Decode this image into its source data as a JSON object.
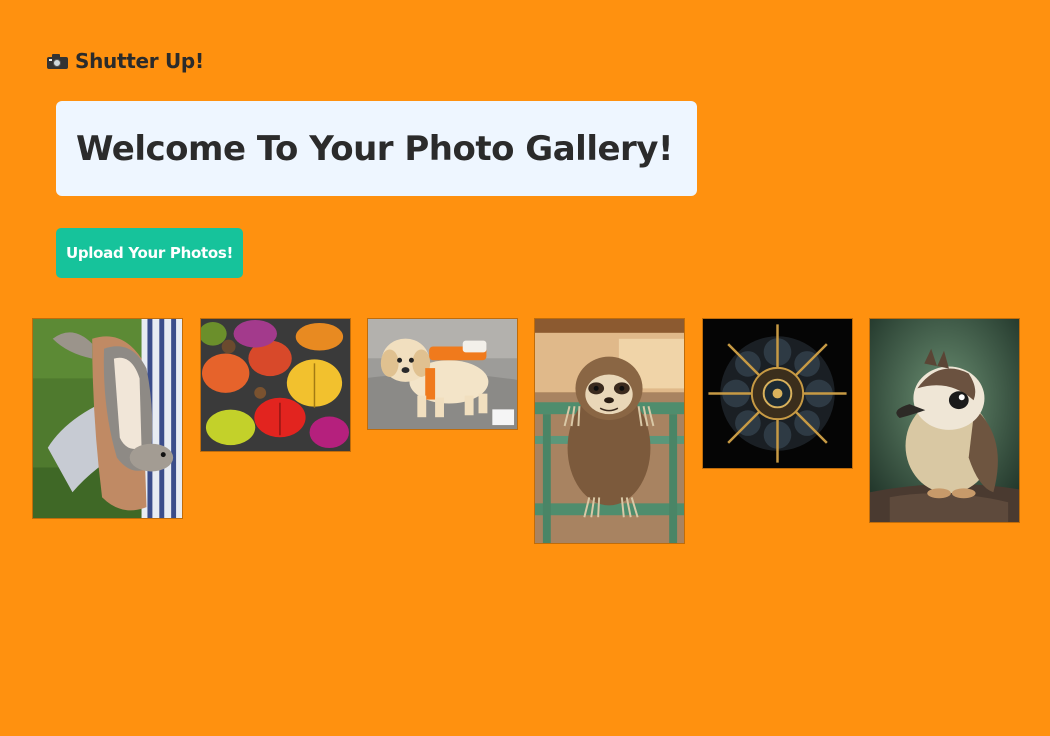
{
  "brand": {
    "icon": "camera-icon",
    "name": "Shutter Up!"
  },
  "hero": {
    "title": "Welcome To Your Photo Gallery!"
  },
  "actions": {
    "upload_label": "Upload Your Photos!"
  },
  "colors": {
    "background": "#FF910F",
    "hero_background": "#EEF6FF",
    "button": "#16C39B",
    "text": "#2B2B2B"
  }
}
